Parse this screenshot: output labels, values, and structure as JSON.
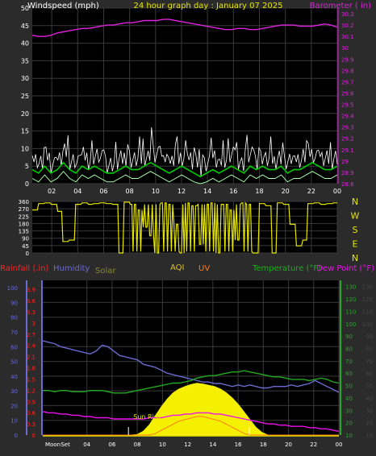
{
  "page_title": "24 hour graph day : January 07 2025",
  "colors": {
    "background": "#2b2b2b",
    "plot_bg": "#000000",
    "grid": "#3a3a3a",
    "wind_avg": "#00cc00",
    "wind_gust": "#ffffff",
    "wind_low": "#aaffaa",
    "barometer": "#dd22dd",
    "wind_dir": "#e6e600",
    "humidity": "#6a6ad0",
    "temperature": "#22aa22",
    "dew_point": "#ee11ee",
    "solar": "#f5f000",
    "uv": "#ff7a1a",
    "aqi": "#d8c030",
    "rainfall": "#ff2222"
  },
  "chart_data": [
    {
      "type": "line",
      "title": "24 hour graph day : January 07 2025",
      "series_labels": [
        "Windspeed (mph)",
        "Barometer ( in)"
      ],
      "x_ticks": [
        "02",
        "04",
        "06",
        "08",
        "10",
        "12",
        "14",
        "16",
        "18",
        "20",
        "22",
        "00"
      ],
      "y_left_ticks": [
        "0",
        "5",
        "10",
        "15",
        "20",
        "25",
        "30",
        "35",
        "40",
        "45",
        "50"
      ],
      "y_right_ticks": [
        "28.8",
        "28.9",
        "29",
        "29.1",
        "29.2",
        "29.3",
        "29.4",
        "29.5",
        "29.6",
        "29.7",
        "29.8",
        "29.9",
        "30",
        "30.1",
        "30.2",
        "30.3"
      ],
      "y_left_range": [
        0,
        50
      ],
      "y_right_range": [
        28.8,
        30.35
      ],
      "x_range_hours": [
        0.5,
        24
      ],
      "series": [
        {
          "name": "Windspeed (mph)",
          "values": [
            4,
            3,
            5,
            3,
            4,
            6,
            4,
            3,
            5,
            4,
            5,
            4,
            3,
            3,
            4,
            5,
            4,
            4,
            5,
            6,
            5,
            4,
            3,
            4,
            5,
            4,
            3,
            2,
            3,
            4,
            3,
            4,
            5,
            4,
            3,
            5,
            4,
            5,
            4,
            4,
            5,
            3,
            4,
            4,
            5,
            6,
            5,
            4,
            4,
            5
          ]
        },
        {
          "name": "Barometer ( in)",
          "values": [
            30.11,
            30.1,
            30.1,
            30.11,
            30.13,
            30.14,
            30.15,
            30.16,
            30.17,
            30.17,
            30.18,
            30.19,
            30.2,
            30.2,
            30.21,
            30.22,
            30.22,
            30.23,
            30.24,
            30.24,
            30.24,
            30.25,
            30.25,
            30.24,
            30.23,
            30.22,
            30.21,
            30.2,
            30.19,
            30.18,
            30.17,
            30.16,
            30.16,
            30.17,
            30.17,
            30.16,
            30.16,
            30.17,
            30.18,
            30.19,
            30.2,
            30.2,
            30.2,
            30.19,
            30.19,
            30.19,
            30.2,
            30.21,
            30.2,
            30.18
          ]
        }
      ]
    },
    {
      "type": "line",
      "title": "",
      "y_ticks": [
        "360",
        "270",
        "225",
        "180",
        "135",
        "90",
        "45",
        "0"
      ],
      "y_range": [
        0,
        360
      ],
      "compass_labels": [
        "N",
        "W",
        "S",
        "E",
        "N"
      ],
      "series": [
        {
          "name": "wind direction",
          "values": [
            300,
            345,
            350,
            340,
            290,
            80,
            90,
            340,
            350,
            340,
            345,
            350,
            345,
            340,
            0,
            355,
            340,
            300,
            180,
            120,
            0,
            350,
            340,
            200,
            0,
            350,
            330,
            60,
            340,
            350,
            0,
            340,
            300,
            90,
            350,
            340,
            0,
            345,
            330,
            0,
            350,
            340,
            200,
            50,
            90,
            345,
            350,
            340,
            345,
            350
          ]
        }
      ]
    },
    {
      "type": "line",
      "series_labels": [
        "Rainfall (.in)",
        "Humidity",
        "Solar",
        "AQI",
        "UV",
        "Temperature (°F)",
        "Dew Point (°F)"
      ],
      "x_ticks": [
        "Moon",
        "Set",
        "04",
        "06",
        "08",
        "10",
        "12",
        "14",
        "16",
        "18",
        "20",
        "22",
        "00"
      ],
      "annotations": [
        "Sun Rise"
      ],
      "y_rain_ticks": [
        "0",
        "0.3",
        "0.6",
        "0.9",
        "1.2",
        "1.5",
        "1.8",
        "2.1",
        "2.4",
        "2.7",
        "3",
        "3.3",
        "3.6",
        "3.9"
      ],
      "y_humidity_ticks": [
        "0",
        "10",
        "20",
        "30",
        "40",
        "50",
        "60",
        "70",
        "80",
        "90",
        "100"
      ],
      "y_temp_ticks": [
        "10",
        "20",
        "30",
        "40",
        "50",
        "60",
        "70",
        "80",
        "90",
        "100",
        "110",
        "120",
        "130"
      ],
      "y_humidity_range": [
        0,
        105
      ],
      "y_temp_range": [
        10,
        135
      ],
      "series": [
        {
          "name": "Humidity",
          "values": [
            64,
            63,
            62,
            60,
            59,
            58,
            57,
            56,
            55,
            57,
            61,
            60,
            57,
            54,
            53,
            52,
            51,
            48,
            47,
            46,
            44,
            42,
            41,
            40,
            39,
            38,
            37,
            36,
            36,
            35,
            35,
            34,
            33,
            34,
            33,
            34,
            33,
            32,
            32,
            33,
            33,
            33,
            34,
            33,
            34,
            35,
            37,
            35,
            33,
            31,
            29
          ]
        },
        {
          "name": "Temperature (°F)",
          "values": [
            46,
            46,
            45,
            46,
            46,
            45,
            45,
            45,
            46,
            46,
            46,
            45,
            44,
            44,
            44,
            45,
            46,
            47,
            48,
            49,
            50,
            51,
            52,
            52,
            53,
            54,
            56,
            57,
            58,
            58,
            59,
            60,
            61,
            61,
            62,
            61,
            60,
            59,
            58,
            57,
            57,
            56,
            55,
            55,
            55,
            54,
            55,
            56,
            55,
            53,
            52
          ]
        },
        {
          "name": "Dew Point (°F)",
          "values": [
            29,
            28,
            28,
            27,
            27,
            26,
            26,
            25,
            25,
            24,
            24,
            24,
            23,
            23,
            23,
            23,
            23,
            23,
            24,
            24,
            24,
            25,
            26,
            26,
            27,
            27,
            28,
            28,
            28,
            27,
            27,
            26,
            25,
            24,
            23,
            22,
            21,
            20,
            19,
            19,
            18,
            18,
            17,
            17,
            17,
            16,
            16,
            15,
            15,
            14,
            13
          ]
        },
        {
          "name": "Solar",
          "values": [
            0,
            0,
            0,
            0,
            0,
            0,
            0,
            0,
            0,
            0,
            0,
            0,
            0,
            0,
            0,
            0,
            5,
            30,
            80,
            150,
            220,
            280,
            330,
            360,
            380,
            395,
            405,
            400,
            390,
            380,
            360,
            330,
            290,
            240,
            180,
            120,
            60,
            20,
            0,
            0,
            0,
            0,
            0,
            0,
            0,
            0,
            0,
            0,
            0,
            0,
            0
          ]
        },
        {
          "name": "UV",
          "values": [
            0,
            0,
            0,
            0,
            0,
            0,
            0,
            0,
            0,
            0,
            0,
            0,
            0,
            0,
            0,
            0,
            0,
            0,
            0,
            0.1,
            0.3,
            0.5,
            0.7,
            0.9,
            1,
            1.1,
            1.2,
            1.2,
            1.1,
            1,
            0.9,
            0.7,
            0.5,
            0.3,
            0.1,
            0,
            0,
            0,
            0,
            0,
            0,
            0,
            0,
            0,
            0,
            0,
            0,
            0,
            0,
            0,
            0
          ]
        },
        {
          "name": "Rainfall (.in)",
          "values": [
            0,
            0,
            0,
            0,
            0,
            0,
            0,
            0,
            0,
            0,
            0,
            0,
            0,
            0,
            0,
            0,
            0,
            0,
            0,
            0,
            0,
            0,
            0,
            0,
            0,
            0,
            0,
            0,
            0,
            0,
            0,
            0,
            0,
            0,
            0,
            0,
            0,
            0,
            0,
            0,
            0,
            0,
            0,
            0,
            0,
            0,
            0,
            0,
            0,
            0,
            0
          ]
        }
      ]
    }
  ]
}
